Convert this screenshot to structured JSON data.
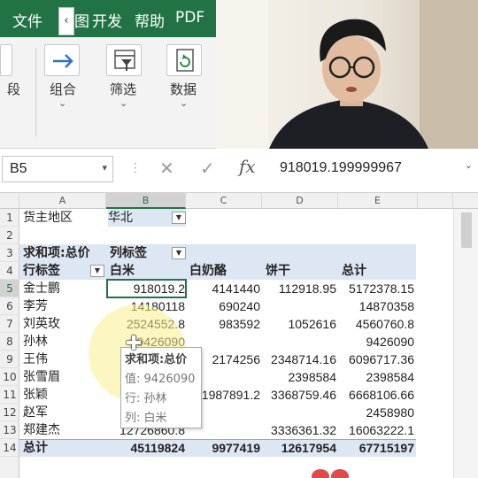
{
  "ribbon": {
    "menu": {
      "file": "文件",
      "scroll_left": "‹",
      "view_fragment": "图",
      "developer": "开发",
      "help": "帮助",
      "pdf": "PDF"
    },
    "tools": {
      "left_fragment": "段",
      "group": "组合",
      "filter": "筛选",
      "data": "数据"
    }
  },
  "formula_bar": {
    "name_box": "B5",
    "formula": "918019.199999967"
  },
  "columns": [
    "A",
    "B",
    "C",
    "D",
    "E"
  ],
  "rows": [
    "1",
    "2",
    "3",
    "4",
    "5",
    "6",
    "7",
    "8",
    "9",
    "10",
    "11",
    "12",
    "13",
    "14"
  ],
  "pivot": {
    "filter_label": "货主地区",
    "filter_value": "华北",
    "sum_label": "求和项:总价",
    "col_label": "列标签",
    "row_label": "行标签",
    "col_headers": [
      "白米",
      "白奶酪",
      "饼干",
      "总计"
    ],
    "body": [
      {
        "name": "金士鹏",
        "v": [
          "918019.2",
          "4141440",
          "112918.95",
          "5172378.15"
        ]
      },
      {
        "name": "李芳",
        "v": [
          "14180118",
          "690240",
          "",
          "14870358"
        ]
      },
      {
        "name": "刘英玫",
        "v": [
          "2524552.8",
          "983592",
          "1052616",
          "4560760.8"
        ]
      },
      {
        "name": "孙林",
        "v": [
          "9426090",
          "",
          "",
          "9426090"
        ]
      },
      {
        "name": "王伟",
        "v": [
          "",
          "2174256",
          "2348714.16",
          "6096717.36"
        ]
      },
      {
        "name": "张雪眉",
        "v": [
          "",
          "",
          "2398584",
          "2398584"
        ]
      },
      {
        "name": "张颖",
        "v": [
          "",
          "1987891.2",
          "3368759.46",
          "6668106.66"
        ]
      },
      {
        "name": "赵军",
        "v": [
          "",
          "",
          "",
          "2458980"
        ]
      },
      {
        "name": "郑建杰",
        "v": [
          "12726860.8",
          "",
          "3336361.32",
          "16063222.1"
        ]
      }
    ],
    "total_label": "总计",
    "totals": [
      "45119824",
      "9977419",
      "12617954",
      "67715197"
    ]
  },
  "tooltip": {
    "title": "求和项:总价",
    "value": "值: 9426090",
    "row": "行: 孙林",
    "col": "列: 白米"
  },
  "colors": {
    "excel_green": "#217346",
    "pivot_band": "#dde6f3"
  }
}
